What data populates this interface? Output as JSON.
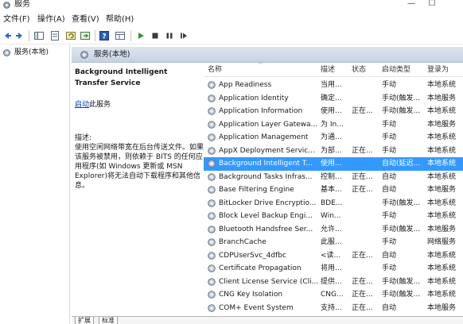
{
  "window": {
    "title": "服务",
    "minimize": "—",
    "maximize": "☐"
  },
  "menu": [
    {
      "label": "文件(F)"
    },
    {
      "label": "操作(A)"
    },
    {
      "label": "查看(V)"
    },
    {
      "label": "帮助(H)"
    }
  ],
  "toolbar": {
    "buttons": [
      "back-icon",
      "forward-icon",
      "console-tree-icon",
      "properties-icon",
      "refresh-icon",
      "export-icon",
      "help-icon",
      "view-icon",
      "start-icon",
      "stop-icon",
      "pause-icon",
      "restart-icon"
    ]
  },
  "tree": {
    "item": "服务(本地)"
  },
  "pane": {
    "title": "服务(本地)"
  },
  "description": {
    "service_title": "Background Intelligent Transfer Service",
    "link_text": "启动",
    "link_suffix": "此服务",
    "heading": "描述:",
    "body": "使用空闲网络带宽在后台传送文件。如果该服务被禁用，则依赖于 BITS 的任何应用程序(如 Windows 更新或 MSN Explorer)将无法自动下载程序和其他信息。"
  },
  "columns": {
    "name": "名称",
    "desc": "描述",
    "status": "状态",
    "startup": "启动类型",
    "logon": "登录为"
  },
  "services": [
    {
      "name": "App Readiness",
      "desc": "当用...",
      "status": "",
      "startup": "手动",
      "logon": "本地系统"
    },
    {
      "name": "Application Identity",
      "desc": "确定...",
      "status": "",
      "startup": "手动(触发...",
      "logon": "本地服务"
    },
    {
      "name": "Application Information",
      "desc": "使用...",
      "status": "正在...",
      "startup": "手动(触发...",
      "logon": "本地系统"
    },
    {
      "name": "Application Layer Gatewa...",
      "desc": "为 In...",
      "status": "",
      "startup": "手动",
      "logon": "本地服务"
    },
    {
      "name": "Application Management",
      "desc": "为通...",
      "status": "",
      "startup": "手动",
      "logon": "本地系统"
    },
    {
      "name": "AppX Deployment Servic...",
      "desc": "为部...",
      "status": "正在...",
      "startup": "手动",
      "logon": "本地系统"
    },
    {
      "name": "Background Intelligent T...",
      "desc": "使用...",
      "status": "",
      "startup": "自动(延迟...",
      "logon": "本地系统"
    },
    {
      "name": "Background Tasks Infras...",
      "desc": "控制...",
      "status": "正在...",
      "startup": "自动",
      "logon": "本地系统"
    },
    {
      "name": "Base Filtering Engine",
      "desc": "基本...",
      "status": "正在...",
      "startup": "自动",
      "logon": "本地服务"
    },
    {
      "name": "BitLocker Drive Encryptio...",
      "desc": "BDE...",
      "status": "",
      "startup": "手动(触发...",
      "logon": "本地系统"
    },
    {
      "name": "Block Level Backup Engi...",
      "desc": "Win...",
      "status": "",
      "startup": "手动",
      "logon": "本地系统"
    },
    {
      "name": "Bluetooth Handsfree Ser...",
      "desc": "允许...",
      "status": "",
      "startup": "手动(触发...",
      "logon": "本地服务"
    },
    {
      "name": "BranchCache",
      "desc": "此服...",
      "status": "",
      "startup": "手动",
      "logon": "网络服务"
    },
    {
      "name": "CDPUserSvc_4dfbc",
      "desc": "<读...",
      "status": "正在...",
      "startup": "自动",
      "logon": "本地系统"
    },
    {
      "name": "Certificate Propagation",
      "desc": "将用...",
      "status": "",
      "startup": "手动",
      "logon": "本地系统"
    },
    {
      "name": "Client License Service (Cli...",
      "desc": "提供...",
      "status": "正在...",
      "startup": "手动(触发...",
      "logon": "本地系统"
    },
    {
      "name": "CNG Key Isolation",
      "desc": "CNG...",
      "status": "正在...",
      "startup": "手动(触发...",
      "logon": "本地系统"
    },
    {
      "name": "COM+ Event System",
      "desc": "支持...",
      "status": "正在...",
      "startup": "自动",
      "logon": "本地服务"
    }
  ],
  "selected_index": 6,
  "tabs": [
    {
      "label": "扩展"
    },
    {
      "label": "标准"
    }
  ],
  "colors": {
    "selection": "#3399ff",
    "header_gradient_top": "#dde6f0",
    "header_gradient_bottom": "#c4d2e2",
    "link": "#0645ad"
  }
}
